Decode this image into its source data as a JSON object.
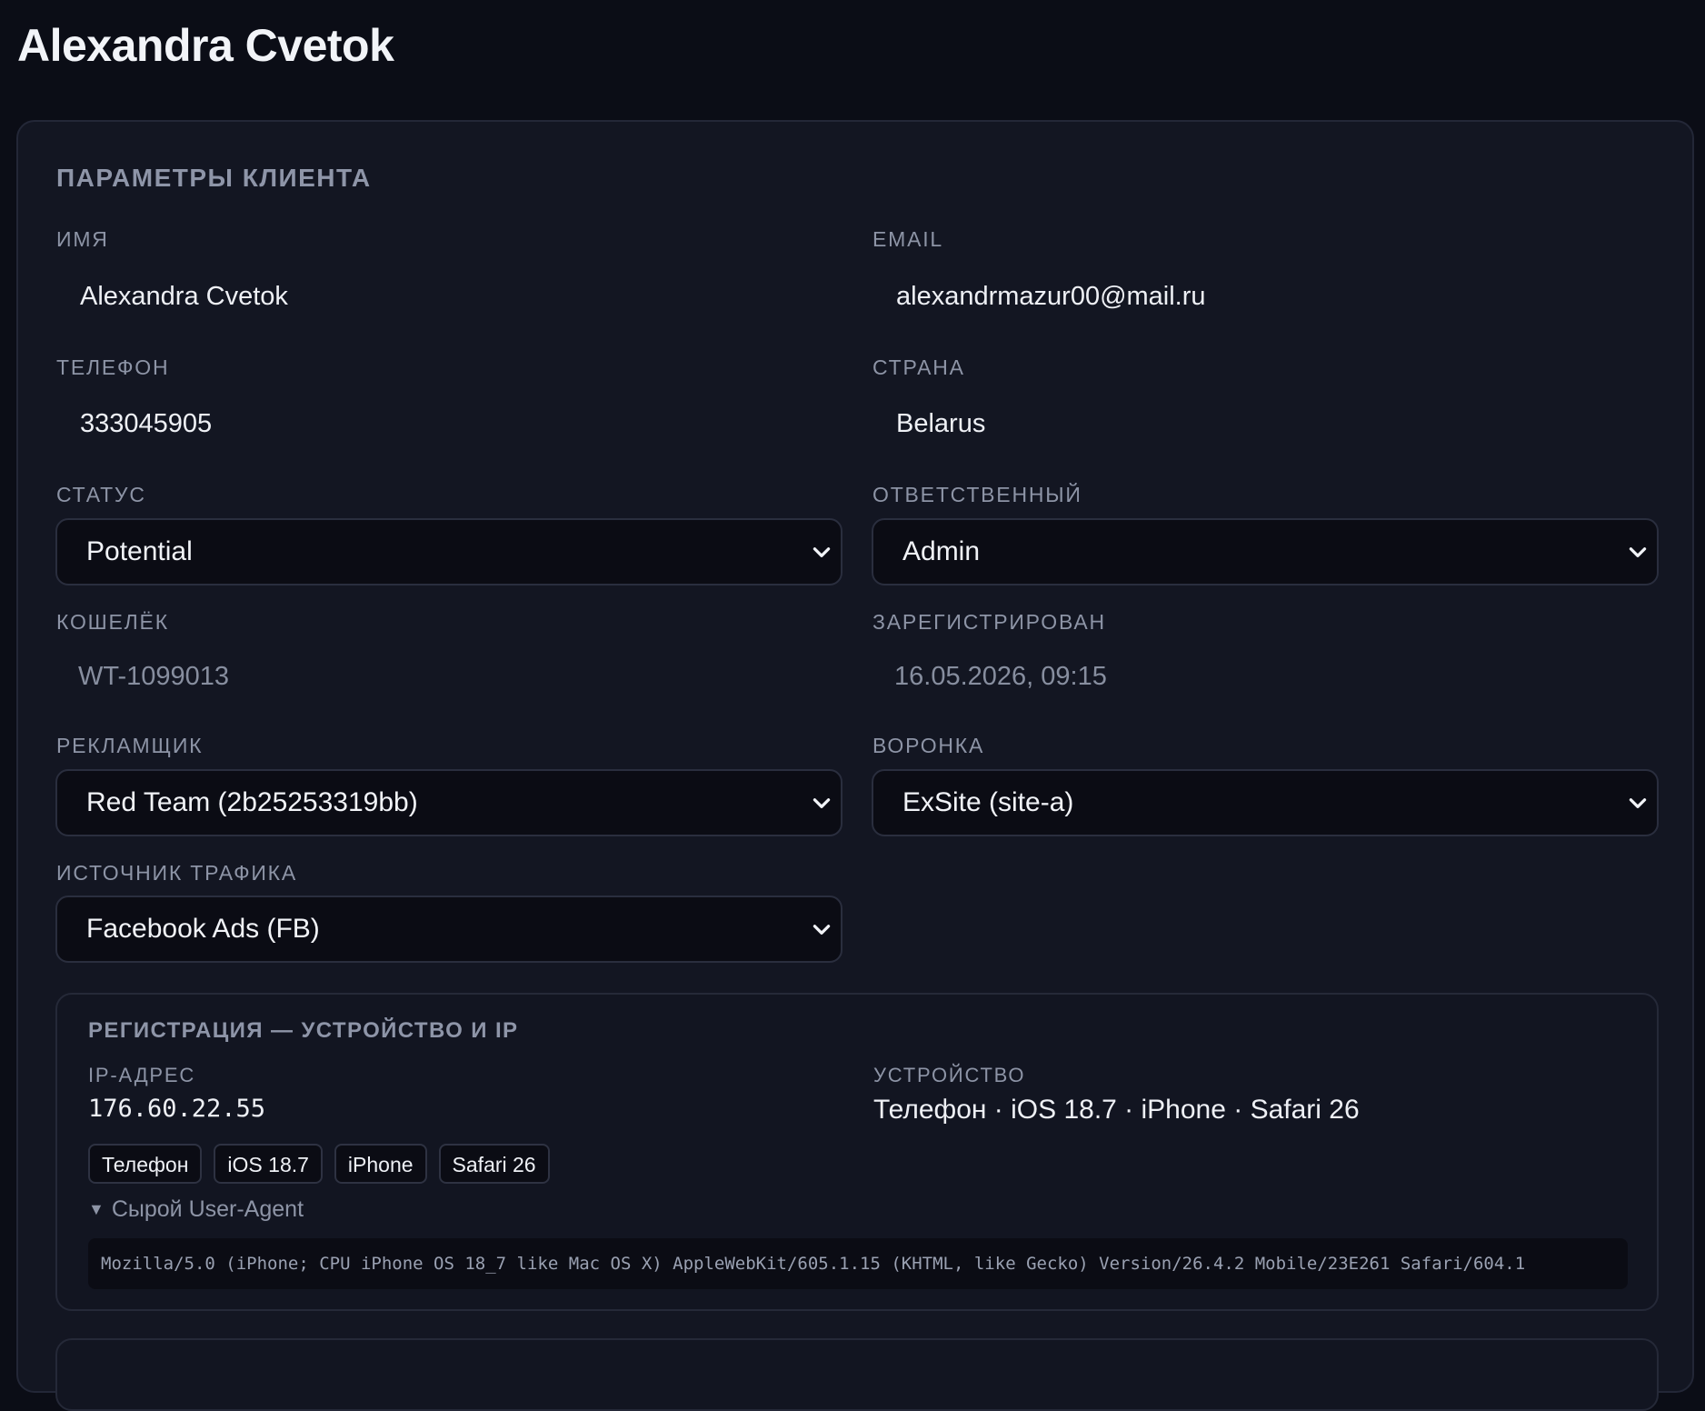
{
  "page": {
    "title": "Alexandra Cvetok"
  },
  "client": {
    "section_title": "ПАРАМЕТРЫ КЛИЕНТА",
    "name": {
      "label": "ИМЯ",
      "value": "Alexandra Cvetok"
    },
    "email": {
      "label": "EMAIL",
      "value": "alexandrmazur00@mail.ru"
    },
    "phone": {
      "label": "ТЕЛЕФОН",
      "value": "333045905"
    },
    "country": {
      "label": "СТРАНА",
      "value": "Belarus"
    },
    "status": {
      "label": "СТАТУС",
      "selected": "Potential"
    },
    "responsible": {
      "label": "ОТВЕТСТВЕННЫЙ",
      "selected": "Admin"
    },
    "wallet": {
      "label": "КОШЕЛЁК",
      "value": "WT-1099013"
    },
    "registered": {
      "label": "ЗАРЕГИСТРИРОВАН",
      "value": "16.05.2026, 09:15"
    },
    "advertiser": {
      "label": "РЕКЛАМЩИК",
      "selected": "Red Team (2b25253319bb)"
    },
    "funnel": {
      "label": "ВОРОНКА",
      "selected": "ExSite (site-a)"
    },
    "traffic_source": {
      "label": "ИСТОЧНИК ТРАФИКА",
      "selected": "Facebook Ads (FB)"
    }
  },
  "registration": {
    "title": "РЕГИСТРАЦИЯ — УСТРОЙСТВО И IP",
    "ip_label": "IP-АДРЕС",
    "ip_value": "176.60.22.55",
    "device_label": "УСТРОЙСТВО",
    "device_value": "Телефон · iOS 18.7 · iPhone · Safari 26",
    "chips": [
      "Телефон",
      "iOS 18.7",
      "iPhone",
      "Safari 26"
    ],
    "ua_toggle_label": "Сырой User-Agent",
    "ua_value": "Mozilla/5.0 (iPhone; CPU iPhone OS 18_7 like Mac OS X) AppleWebKit/605.1.15 (KHTML, like Gecko) Version/26.4.2 Mobile/23E261 Safari/604.1"
  },
  "icons": {
    "select_chevron": "chevron-down-icon",
    "details_toggle": "triangle-down-icon"
  },
  "colors": {
    "background": "#0b0d16",
    "card": "#131622",
    "input": "#0b0c14",
    "label": "#8d94a6",
    "text": "#eef0f5"
  }
}
